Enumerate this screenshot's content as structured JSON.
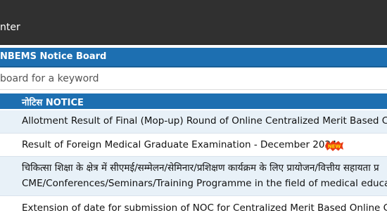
{
  "topbar": {
    "text": "nter"
  },
  "notice_board": {
    "title": "NBEMS Notice Board",
    "search_placeholder": "board for a keyword"
  },
  "section": {
    "title": "नोटिस NOTICE"
  },
  "notices": [
    {
      "text": "Allotment Result of Final (Mop-up) Round of Online Centralized Merit Based Cou"
    },
    {
      "text": "Result of Foreign Medical Graduate Examination - December 2024",
      "badge": "NEW"
    },
    {
      "line1": "चिकित्सा शिक्षा के क्षेत्र में सीएमई/सम्मेलन/सेमिनार/प्रशिक्षण कार्यक्रम के लिए प्रायोजन/वित्तीय सहायता प्र",
      "line2": "CME/Conferences/Seminars/Training Programme in the field of medical educatio"
    },
    {
      "text": "Extension of date for submission of NOC for Centralized Merit Based Online Cou"
    }
  ],
  "colors": {
    "header": "#303030",
    "accent": "#1d6fb1",
    "row_alt": "#e8f1f8",
    "badge": "#e83a16"
  }
}
